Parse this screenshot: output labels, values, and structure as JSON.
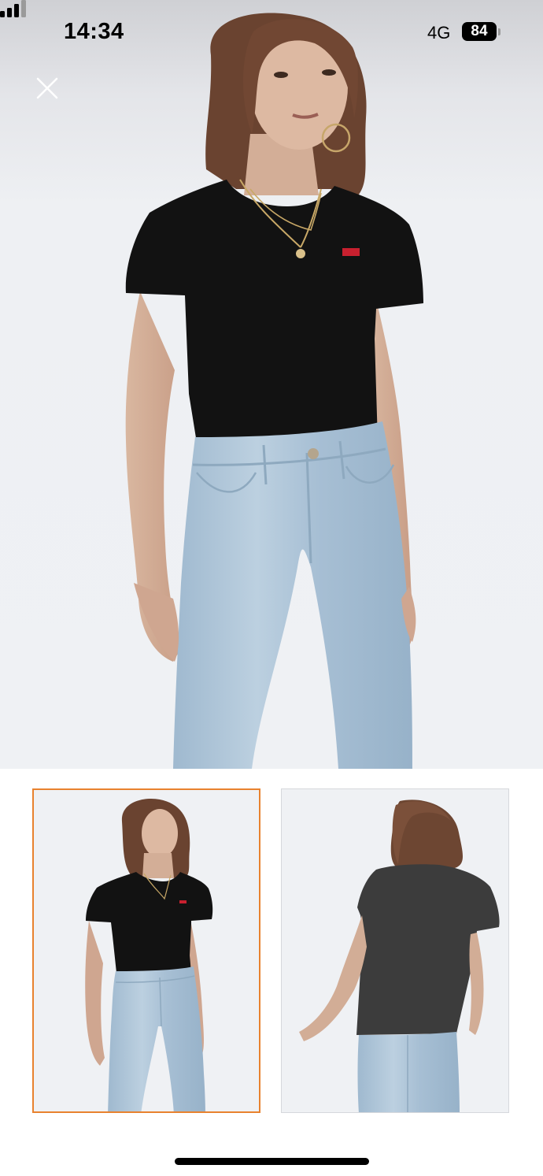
{
  "status_bar": {
    "time": "14:34",
    "network": "4G",
    "battery": "84",
    "icons": [
      "signal-bars-icon",
      "battery-icon"
    ]
  },
  "viewer": {
    "close_icon": "close-icon",
    "main_image": "model-front-view",
    "thumbnails": [
      {
        "view": "front",
        "selected": true
      },
      {
        "view": "back",
        "selected": false
      }
    ]
  },
  "colors": {
    "selected_border": "#e8822e",
    "shirt": "#111111",
    "denim": "#a9c2d6",
    "backdrop": "#eff1f4",
    "logo_tab": "#c8202f"
  }
}
